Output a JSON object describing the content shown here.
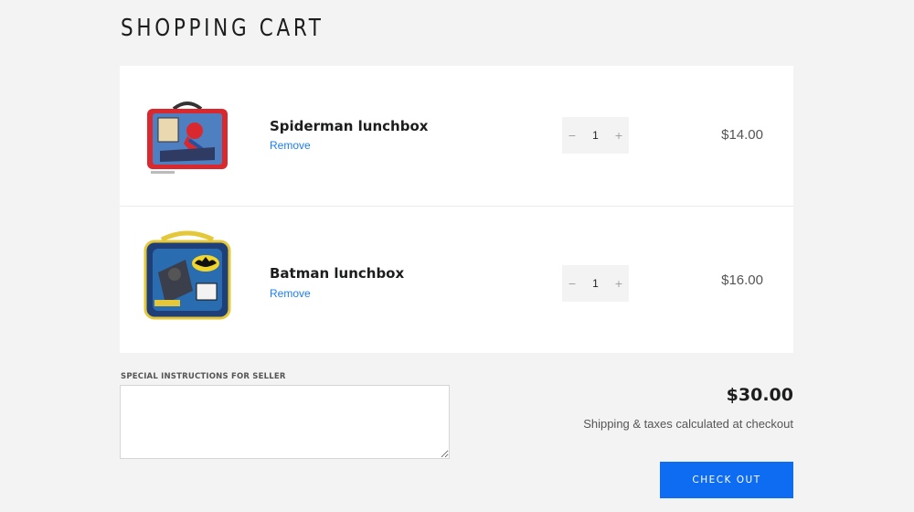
{
  "page": {
    "title": "SHOPPING CART"
  },
  "cart": {
    "items": [
      {
        "name": "Spiderman lunchbox",
        "remove_label": "Remove",
        "quantity": "1",
        "price": "$14.00",
        "icon": "spiderman-lunchbox-image",
        "decrement": "−",
        "increment": "+"
      },
      {
        "name": "Batman lunchbox",
        "remove_label": "Remove",
        "quantity": "1",
        "price": "$16.00",
        "icon": "batman-lunchbox-image",
        "decrement": "−",
        "increment": "+"
      }
    ]
  },
  "notes": {
    "label": "SPECIAL INSTRUCTIONS FOR SELLER",
    "value": ""
  },
  "summary": {
    "subtotal": "$30.00",
    "shipping_note": "Shipping & taxes calculated at checkout",
    "checkout_label": "CHECK OUT"
  },
  "colors": {
    "accent": "#0d6cf2",
    "link": "#1b7ef2",
    "background": "#f3f3f3"
  }
}
